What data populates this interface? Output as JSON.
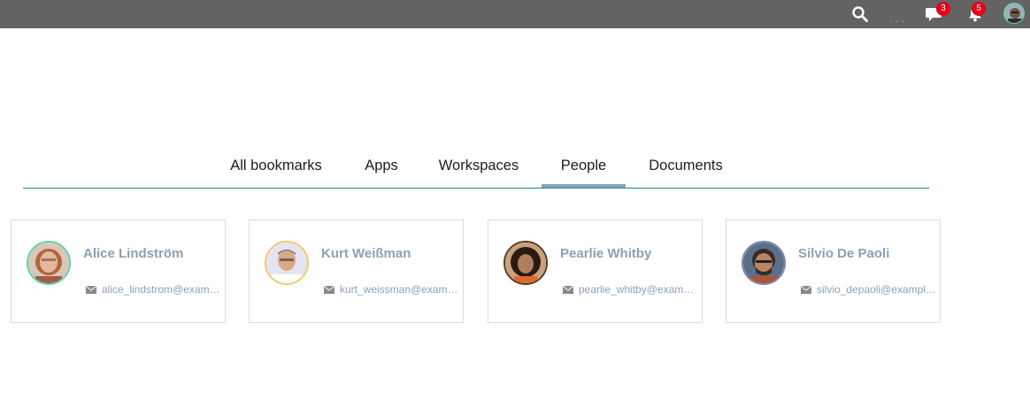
{
  "topbar": {
    "search_icon": "search-icon",
    "more_label": "...",
    "chat_badge": "3",
    "notifications_badge": "5",
    "background": "#636363"
  },
  "tabs": [
    {
      "label": "All bookmarks",
      "active": false
    },
    {
      "label": "Apps",
      "active": false
    },
    {
      "label": "Workspaces",
      "active": false
    },
    {
      "label": "People",
      "active": true
    },
    {
      "label": "Documents",
      "active": false
    }
  ],
  "people": [
    {
      "name": "Alice Lindström",
      "email": "alice_lindstrom@example.com"
    },
    {
      "name": "Kurt Weißman",
      "email": "kurt_weissman@example.com"
    },
    {
      "name": "Pearlie Whitby",
      "email": "pearlie_whitby@example.com"
    },
    {
      "name": "Silvio De Paoli",
      "email": "silvio_depaoli@example.com"
    }
  ],
  "colors": {
    "accent_text": "#8da0b6",
    "tab_underline": "#1d8d8a",
    "badge": "#e3001b",
    "avatar_ring": "#5fd3a7"
  }
}
